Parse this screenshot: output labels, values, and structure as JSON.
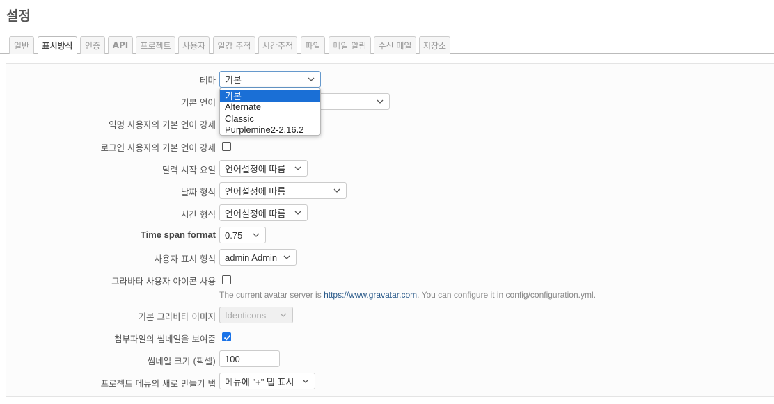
{
  "page_title": "설정",
  "tabs": [
    {
      "label": "일반",
      "selected": false
    },
    {
      "label": "표시방식",
      "selected": true
    },
    {
      "label": "인증",
      "selected": false
    },
    {
      "label": "API",
      "selected": false
    },
    {
      "label": "프로젝트",
      "selected": false
    },
    {
      "label": "사용자",
      "selected": false
    },
    {
      "label": "일감 추적",
      "selected": false
    },
    {
      "label": "시간추적",
      "selected": false
    },
    {
      "label": "파일",
      "selected": false
    },
    {
      "label": "메일 알림",
      "selected": false
    },
    {
      "label": "수신 메일",
      "selected": false
    },
    {
      "label": "저장소",
      "selected": false
    }
  ],
  "form": {
    "theme": {
      "label": "테마",
      "value": "기본"
    },
    "default_language": {
      "label": "기본 언어"
    },
    "force_default_language_anonymous": {
      "label": "익명 사용자의 기본 언어 강제"
    },
    "force_default_language_logged_in": {
      "label": "로그인 사용자의 기본 언어 강제",
      "checked": false
    },
    "start_of_week": {
      "label": "달력 시작 요일",
      "value": "언어설정에 따름"
    },
    "date_format": {
      "label": "날짜 형식",
      "value": "언어설정에 따름"
    },
    "time_format": {
      "label": "시간 형식",
      "value": "언어설정에 따름"
    },
    "timespan_format": {
      "label": "Time span format",
      "value": "0.75"
    },
    "user_format": {
      "label": "사용자 표시 형식",
      "value": "admin Admin"
    },
    "gravatar_enabled": {
      "label": "그라바타 사용자 아이콘 사용",
      "checked": false
    },
    "gravatar_note": {
      "prefix": "The current avatar server is ",
      "link": "https://www.gravatar.com",
      "suffix": ". You can configure it in config/configuration.yml."
    },
    "gravatar_default": {
      "label": "기본 그라바타 이미지",
      "value": "Identicons"
    },
    "thumbnails_enabled": {
      "label": "첨부파일의 썸네일을 보여줌",
      "checked": true
    },
    "thumbnails_size": {
      "label": "썸네일 크기 (픽셀)",
      "value": "100"
    },
    "new_item_menu_tab": {
      "label": "프로젝트 메뉴의 새로 만들기 탭",
      "value": "메뉴에 \"+\" 탭 표시"
    }
  },
  "theme_dropdown": {
    "options": [
      "기본",
      "Alternate",
      "Classic",
      "Purplemine2-2.16.2"
    ],
    "highlighted": "기본"
  },
  "colors": {
    "highlight": "#1a6fd6",
    "checkbox_checked": "#1a73e8",
    "link": "#2a5a8a"
  }
}
